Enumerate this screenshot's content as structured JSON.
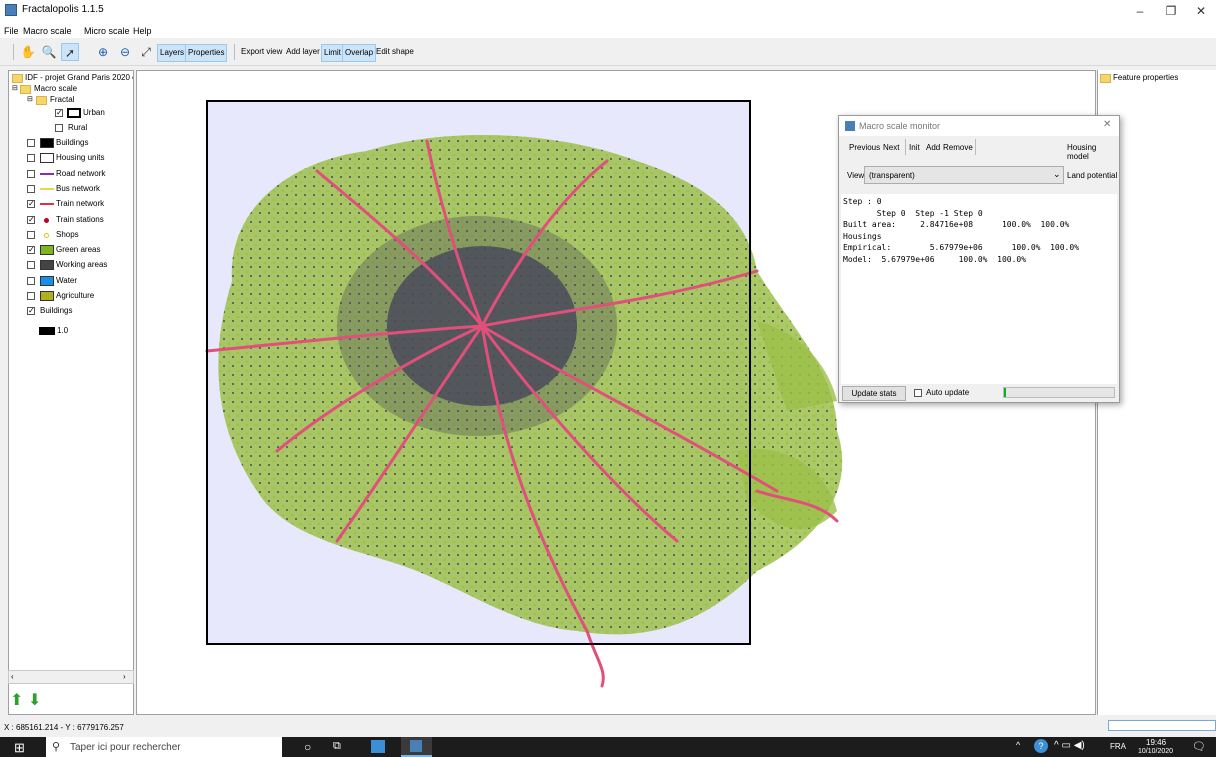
{
  "window": {
    "title": "Fractalopolis 1.1.5",
    "minimize": "–",
    "restore": "❐",
    "close": "✕"
  },
  "menubar": [
    "File",
    "Macro scale",
    "Micro scale",
    "Help"
  ],
  "toolbar": {
    "buttons": [
      "Layers",
      "Properties",
      "Export view",
      "Add layer",
      "Limit",
      "Overlap",
      "Edit shape"
    ]
  },
  "tree": {
    "project": "IDF - projet Grand Paris 2020 ç",
    "macro": "Macro scale",
    "fractal": "Fractal",
    "urban": "Urban",
    "rural": "Rural",
    "layers": [
      {
        "label": "Buildings",
        "checked": false,
        "color": "#000000",
        "kind": "box"
      },
      {
        "label": "Housing units",
        "checked": false,
        "color": "#ffffff",
        "kind": "box"
      },
      {
        "label": "Road network",
        "checked": false,
        "color": "#8b2fa8",
        "kind": "line"
      },
      {
        "label": "Bus network",
        "checked": false,
        "color": "#f2d24a",
        "kind": "line"
      },
      {
        "label": "Train network",
        "checked": true,
        "color": "#e0304a",
        "kind": "line"
      },
      {
        "label": "Train stations",
        "checked": true,
        "color": "#c00020",
        "kind": "dot"
      },
      {
        "label": "Shops",
        "checked": false,
        "color": "#e6c200",
        "kind": "ring"
      },
      {
        "label": "Green areas",
        "checked": true,
        "color": "#7fb520",
        "kind": "box"
      },
      {
        "label": "Working areas",
        "checked": false,
        "color": "#444444",
        "kind": "box"
      },
      {
        "label": "Water",
        "checked": false,
        "color": "#1a8fe6",
        "kind": "box"
      },
      {
        "label": "Agriculture",
        "checked": false,
        "color": "#b0b020",
        "kind": "box"
      },
      {
        "label": "Buildings",
        "checked": true,
        "color": "",
        "kind": "none"
      }
    ],
    "legend_value": "1.0",
    "check_mark": "✓"
  },
  "right_panel": {
    "title": "Feature properties"
  },
  "monitor": {
    "title": "Macro scale monitor",
    "close": "✕",
    "buttons": [
      "Previous",
      "Next",
      "Init",
      "Add",
      "Remove"
    ],
    "housing_model": "Housing model",
    "view_label": "View",
    "view_value": "(transparent)",
    "land_potential": "Land potential",
    "text": "Step : 0\n       Step 0  Step -1 Step 0\nBuilt area:     2.84716e+08      100.0%  100.0%\nHousings\nEmpirical:        5.67979e+06      100.0%  100.0%\nModel:  5.67979e+06     100.0%  100.0%",
    "update_stats": "Update stats",
    "auto_update": "Auto update"
  },
  "status": {
    "coords": "X : 685161.214 - Y : 6779176.257"
  },
  "taskbar": {
    "search_placeholder": "Taper ici pour rechercher",
    "lang": "FRA",
    "time": "19:46",
    "date": "10/10/2020"
  },
  "colors": {
    "map_bg": "#e8e8fc",
    "green": "#9cc04a",
    "urban": "#4a4a5a",
    "rail": "#e0507a",
    "frame": "#000000",
    "selection": "#cce4f7"
  }
}
